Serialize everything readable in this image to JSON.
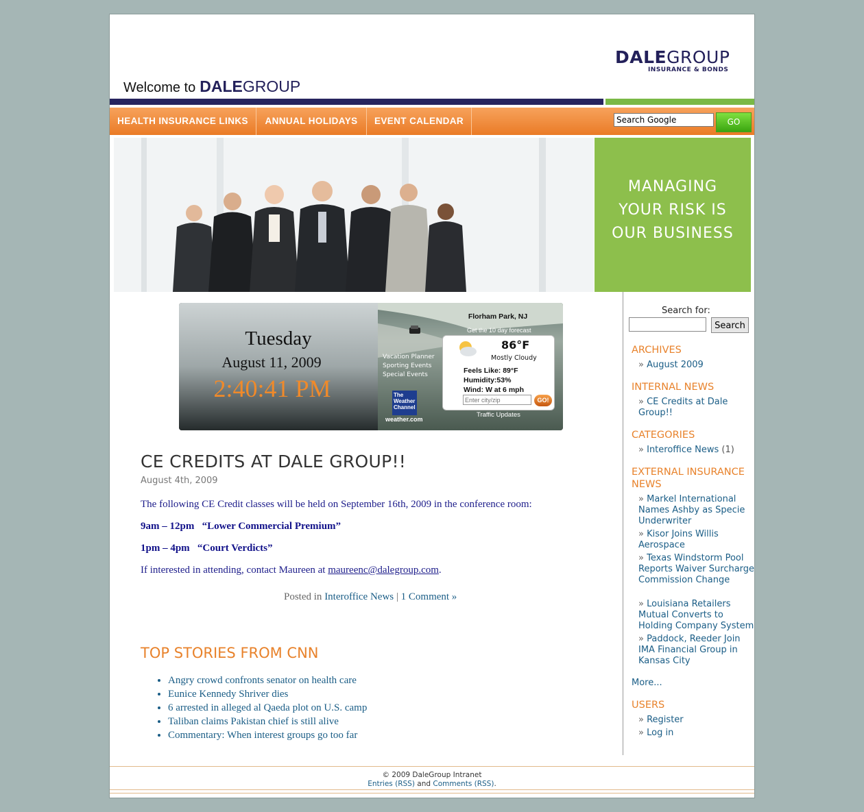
{
  "header": {
    "logo_bold": "DALE",
    "logo_light": "GROUP",
    "logo_tagline": "INSURANCE & BONDS",
    "welcome_text": "Welcome to",
    "welcome_bold": "DALE",
    "welcome_light": "GROUP"
  },
  "nav": {
    "items": [
      "HEALTH INSURANCE LINKS",
      "ANNUAL HOLIDAYS",
      "EVENT CALENDAR"
    ],
    "search_value": "Search Google",
    "go_label": "GO"
  },
  "hero": {
    "tagline_line1": "MANAGING",
    "tagline_line2": "YOUR RISK IS",
    "tagline_line3": "OUR BUSINESS",
    "accent_color": "#8dbf4c"
  },
  "widget": {
    "day": "Tuesday",
    "date": "August 11, 2009",
    "time": "2:40:41 PM",
    "location": "Florham Park, NJ",
    "forecast_link": "Get the 10 day forecast",
    "links": [
      "Vacation Planner",
      "Sporting Events",
      "Special Events"
    ],
    "temp": "86°F",
    "condition": "Mostly Cloudy",
    "feels_like": "Feels Like: 89°F",
    "humidity": "Humidity:53%",
    "wind": "Wind: W at 6 mph",
    "city_placeholder": "Enter city/zip",
    "go_label": "GO!",
    "traffic": "Traffic Updates",
    "brand_line1": "The",
    "brand_line2": "Weather",
    "brand_line3": "Channel",
    "brand_url": "weather.com"
  },
  "post": {
    "title": "CE CREDITS AT DALE GROUP!!",
    "date": "August 4th, 2009",
    "intro": "The following CE Credit classes will be held on September 16th, 2009 in the conference room:",
    "class1": "9am – 12pm   “Lower Commercial Premium”",
    "class2": "1pm – 4pm   “Court Verdicts”",
    "contact_text": "If interested in attending, contact Maureen at",
    "contact_email": "maureenc@dalegroup.com",
    "contact_end": ".",
    "posted_in": "Posted in",
    "category_link": "Interoffice News",
    "separator": "|",
    "comments_link": "1 Comment »"
  },
  "cnn": {
    "heading": "TOP STORIES FROM CNN",
    "stories": [
      "Angry crowd confronts senator on health care",
      "Eunice Kennedy Shriver dies",
      "6 arrested in alleged al Qaeda plot on U.S. camp",
      "Taliban claims Pakistan chief is still alive",
      "Commentary: When interest groups go too far"
    ]
  },
  "sidebar": {
    "search_label": "Search for:",
    "search_button": "Search",
    "archives_heading": "ARCHIVES",
    "archives": [
      "August 2009"
    ],
    "internal_heading": "INTERNAL NEWS",
    "internal": [
      "CE Credits at Dale Group!!"
    ],
    "categories_heading": "CATEGORIES",
    "category_name": "Interoffice News",
    "category_count": "(1)",
    "external_heading": "EXTERNAL INSURANCE NEWS",
    "external": [
      "Markel International Names Ashby as Specie Underwriter",
      "Kisor Joins Willis Aerospace",
      "Texas Windstorm Pool Reports Waiver Surcharge Commission Change",
      "Louisiana Retailers Mutual Converts to Holding Company System",
      "Paddock, Reeder Join IMA Financial Group in Kansas City"
    ],
    "more": "More...",
    "users_heading": "USERS",
    "register": "Register",
    "login": "Log in",
    "arrow": "»"
  },
  "footer": {
    "copyright": "© 2009 DaleGroup Intranet",
    "entries": "Entries (RSS)",
    "and": "and",
    "comments": "Comments (RSS)",
    "end": "."
  }
}
